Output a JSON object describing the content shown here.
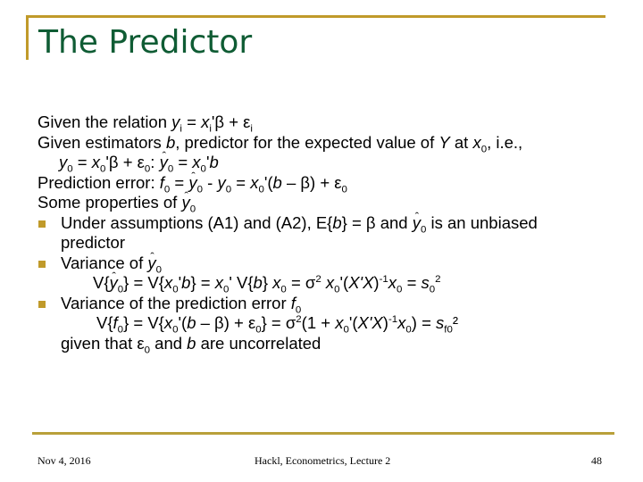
{
  "slide": {
    "title": "The Predictor",
    "lines": {
      "l1": {
        "prefix": "Given the relation ",
        "eq": "y_i = x_i'β + ε_i"
      },
      "l2": {
        "text": "Given estimators b, predictor for the expected value of Y at x0, i.e.,"
      },
      "l3": {
        "eq": "y0 = x0'β + ε0: ŷ0 = x0'b"
      },
      "l4": {
        "prefix": "Prediction error: ",
        "eq": "f0 = ŷ0 - y0 = x0'(b – β) + ε0"
      },
      "l5": {
        "text": "Some properties of ŷ0"
      },
      "b1": {
        "text": "Under assumptions (A1) and (A2), E{b} = β and ŷ0 is an unbiased",
        "cont": "predictor"
      },
      "b2": {
        "text": "Variance of ŷ0",
        "formula": "V{ŷ0} = V{x0'b} = x0' V{b} x0 = σ2 x0'(X'X)-1x0 = s0 2"
      },
      "b3": {
        "text": "Variance of  the prediction error f0",
        "formula": "V{f0} = V{x0'(b – β) + ε0} = σ2(1 + x0'(X'X)-1x0) = sf0 2",
        "note": "given that ε0 and b are uncorrelated"
      }
    },
    "words": {
      "given_the_relation": "Given the relation ",
      "given_estimators": "Given estimators ",
      "predictor_for": ", predictor for the expected value of ",
      "at": " at ",
      "ie": ", i.e.,",
      "prediction_error": "Prediction error: ",
      "some_properties": "Some properties of ",
      "under_assumptions": "Under assumptions (A1) and (A2), E{",
      "eq_beta_and": "} = β and ",
      "is_unbiased": " is an unbiased",
      "predictor": "predictor",
      "variance_of": "Variance of ",
      "variance_pred_error": "Variance of  the prediction error ",
      "given_that": "given that ",
      "and": " and ",
      "uncorrelated": " are uncorrelated"
    }
  },
  "footer": {
    "date": "Nov 4, 2016",
    "center": "Hackl, Econometrics, Lecture 2",
    "page": "48"
  },
  "colors": {
    "title": "#0f5c34",
    "accent": "#c09a2a",
    "footer_rule": "#b9a03a"
  }
}
